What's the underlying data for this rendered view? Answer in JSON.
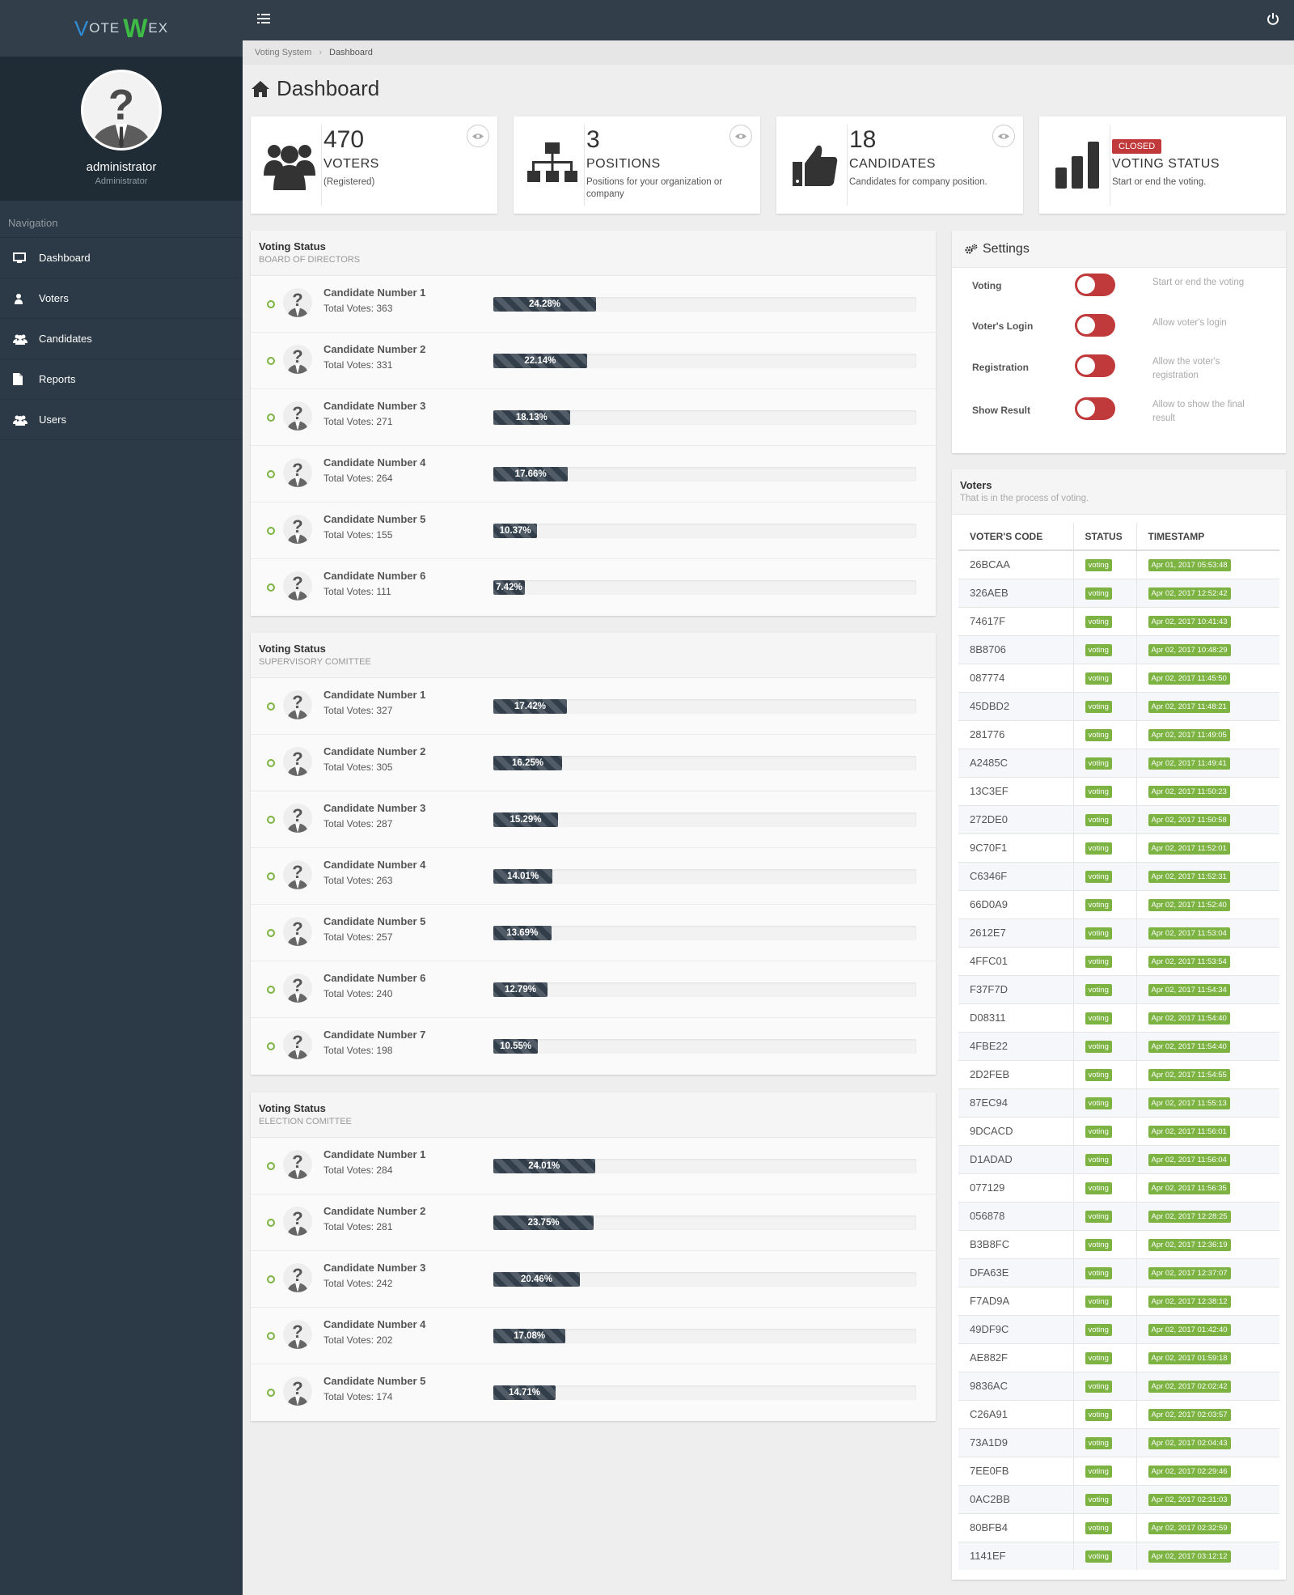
{
  "brand": {
    "part1": "V",
    "part2": "OTE",
    "part3": "W",
    "part4": "EX"
  },
  "profile": {
    "name": "administrator",
    "role": "Administrator"
  },
  "navigation": {
    "title": "Navigation",
    "items": [
      {
        "label": "Dashboard",
        "icon": "monitor-icon"
      },
      {
        "label": "Voters",
        "icon": "user-icon"
      },
      {
        "label": "Candidates",
        "icon": "users-icon"
      },
      {
        "label": "Reports",
        "icon": "file-icon"
      },
      {
        "label": "Users",
        "icon": "users-icon"
      }
    ]
  },
  "breadcrumb": {
    "root": "Voting System",
    "current": "Dashboard"
  },
  "page_title": "Dashboard",
  "stats": {
    "voters": {
      "number": "470",
      "title": "VOTERS",
      "desc": "(Registered)"
    },
    "positions": {
      "number": "3",
      "title": "POSITIONS",
      "desc": "Positions for your organization or company"
    },
    "candidates": {
      "number": "18",
      "title": "CANDIDATES",
      "desc": "Candidates for company position."
    },
    "voting_status": {
      "badge": "CLOSED",
      "title": "VOTING STATUS",
      "desc": "Start or end the voting."
    }
  },
  "voting_panels": [
    {
      "title": "Voting Status",
      "subtitle": "BOARD OF DIRECTORS",
      "candidates": [
        {
          "name": "Candidate Number 1",
          "votes": "Total Votes: 363",
          "percent": 24.28,
          "percent_label": "24.28%"
        },
        {
          "name": "Candidate Number 2",
          "votes": "Total Votes: 331",
          "percent": 22.14,
          "percent_label": "22.14%"
        },
        {
          "name": "Candidate Number 3",
          "votes": "Total Votes: 271",
          "percent": 18.13,
          "percent_label": "18.13%"
        },
        {
          "name": "Candidate Number 4",
          "votes": "Total Votes: 264",
          "percent": 17.66,
          "percent_label": "17.66%"
        },
        {
          "name": "Candidate Number 5",
          "votes": "Total Votes: 155",
          "percent": 10.37,
          "percent_label": "10.37%"
        },
        {
          "name": "Candidate Number 6",
          "votes": "Total Votes: 111",
          "percent": 7.42,
          "percent_label": "7.42%"
        }
      ]
    },
    {
      "title": "Voting Status",
      "subtitle": "SUPERVISORY COMITTEE",
      "candidates": [
        {
          "name": "Candidate Number 1",
          "votes": "Total Votes: 327",
          "percent": 17.42,
          "percent_label": "17.42%"
        },
        {
          "name": "Candidate Number 2",
          "votes": "Total Votes: 305",
          "percent": 16.25,
          "percent_label": "16.25%"
        },
        {
          "name": "Candidate Number 3",
          "votes": "Total Votes: 287",
          "percent": 15.29,
          "percent_label": "15.29%"
        },
        {
          "name": "Candidate Number 4",
          "votes": "Total Votes: 263",
          "percent": 14.01,
          "percent_label": "14.01%"
        },
        {
          "name": "Candidate Number 5",
          "votes": "Total Votes: 257",
          "percent": 13.69,
          "percent_label": "13.69%"
        },
        {
          "name": "Candidate Number 6",
          "votes": "Total Votes: 240",
          "percent": 12.79,
          "percent_label": "12.79%"
        },
        {
          "name": "Candidate Number 7",
          "votes": "Total Votes: 198",
          "percent": 10.55,
          "percent_label": "10.55%"
        }
      ]
    },
    {
      "title": "Voting Status",
      "subtitle": "ELECTION COMITTEE",
      "candidates": [
        {
          "name": "Candidate Number 1",
          "votes": "Total Votes: 284",
          "percent": 24.01,
          "percent_label": "24.01%"
        },
        {
          "name": "Candidate Number 2",
          "votes": "Total Votes: 281",
          "percent": 23.75,
          "percent_label": "23.75%"
        },
        {
          "name": "Candidate Number 3",
          "votes": "Total Votes: 242",
          "percent": 20.46,
          "percent_label": "20.46%"
        },
        {
          "name": "Candidate Number 4",
          "votes": "Total Votes: 202",
          "percent": 17.08,
          "percent_label": "17.08%"
        },
        {
          "name": "Candidate Number 5",
          "votes": "Total Votes: 174",
          "percent": 14.71,
          "percent_label": "14.71%"
        }
      ]
    }
  ],
  "settings": {
    "title": "Settings",
    "rows": [
      {
        "label": "Voting",
        "hint": "Start or end the voting",
        "on": false
      },
      {
        "label": "Voter's Login",
        "hint": "Allow voter's login",
        "on": false
      },
      {
        "label": "Registration",
        "hint": "Allow the voter's registration",
        "on": false
      },
      {
        "label": "Show Result",
        "hint": "Allow to show the final result",
        "on": false
      }
    ]
  },
  "voters": {
    "title": "Voters",
    "subtitle": "That is in the process of voting.",
    "columns": [
      "VOTER'S CODE",
      "STATUS",
      "TIMESTAMP"
    ],
    "status_label": "voting",
    "rows": [
      {
        "code": "26BCAA",
        "status": "voting",
        "ts": "Apr 01, 2017 05:53:48"
      },
      {
        "code": "326AEB",
        "status": "voting",
        "ts": "Apr 02, 2017 12:52:42"
      },
      {
        "code": "74617F",
        "status": "voting",
        "ts": "Apr 02, 2017 10:41:43"
      },
      {
        "code": "8B8706",
        "status": "voting",
        "ts": "Apr 02, 2017 10:48:29"
      },
      {
        "code": "087774",
        "status": "voting",
        "ts": "Apr 02, 2017 11:45:50"
      },
      {
        "code": "45DBD2",
        "status": "voting",
        "ts": "Apr 02, 2017 11:48:21"
      },
      {
        "code": "281776",
        "status": "voting",
        "ts": "Apr 02, 2017 11:49:05"
      },
      {
        "code": "A2485C",
        "status": "voting",
        "ts": "Apr 02, 2017 11:49:41"
      },
      {
        "code": "13C3EF",
        "status": "voting",
        "ts": "Apr 02, 2017 11:50:23"
      },
      {
        "code": "272DE0",
        "status": "voting",
        "ts": "Apr 02, 2017 11:50:58"
      },
      {
        "code": "9C70F1",
        "status": "voting",
        "ts": "Apr 02, 2017 11:52:01"
      },
      {
        "code": "C6346F",
        "status": "voting",
        "ts": "Apr 02, 2017 11:52:31"
      },
      {
        "code": "66D0A9",
        "status": "voting",
        "ts": "Apr 02, 2017 11:52:40"
      },
      {
        "code": "2612E7",
        "status": "voting",
        "ts": "Apr 02, 2017 11:53:04"
      },
      {
        "code": "4FFC01",
        "status": "voting",
        "ts": "Apr 02, 2017 11:53:54"
      },
      {
        "code": "F37F7D",
        "status": "voting",
        "ts": "Apr 02, 2017 11:54:34"
      },
      {
        "code": "D08311",
        "status": "voting",
        "ts": "Apr 02, 2017 11:54:40"
      },
      {
        "code": "4FBE22",
        "status": "voting",
        "ts": "Apr 02, 2017 11:54:40"
      },
      {
        "code": "2D2FEB",
        "status": "voting",
        "ts": "Apr 02, 2017 11:54:55"
      },
      {
        "code": "87EC94",
        "status": "voting",
        "ts": "Apr 02, 2017 11:55:13"
      },
      {
        "code": "9DCACD",
        "status": "voting",
        "ts": "Apr 02, 2017 11:56:01"
      },
      {
        "code": "D1ADAD",
        "status": "voting",
        "ts": "Apr 02, 2017 11:56:04"
      },
      {
        "code": "077129",
        "status": "voting",
        "ts": "Apr 02, 2017 11:56:35"
      },
      {
        "code": "056878",
        "status": "voting",
        "ts": "Apr 02, 2017 12:28:25"
      },
      {
        "code": "B3B8FC",
        "status": "voting",
        "ts": "Apr 02, 2017 12:36:19"
      },
      {
        "code": "DFA63E",
        "status": "voting",
        "ts": "Apr 02, 2017 12:37:07"
      },
      {
        "code": "F7AD9A",
        "status": "voting",
        "ts": "Apr 02, 2017 12:38:12"
      },
      {
        "code": "49DF9C",
        "status": "voting",
        "ts": "Apr 02, 2017 01:42:40"
      },
      {
        "code": "AE882F",
        "status": "voting",
        "ts": "Apr 02, 2017 01:59:18"
      },
      {
        "code": "9836AC",
        "status": "voting",
        "ts": "Apr 02, 2017 02:02:42"
      },
      {
        "code": "C26A91",
        "status": "voting",
        "ts": "Apr 02, 2017 02:03:57"
      },
      {
        "code": "73A1D9",
        "status": "voting",
        "ts": "Apr 02, 2017 02:04:43"
      },
      {
        "code": "7EE0FB",
        "status": "voting",
        "ts": "Apr 02, 2017 02:29:46"
      },
      {
        "code": "0AC2BB",
        "status": "voting",
        "ts": "Apr 02, 2017 02:31:03"
      },
      {
        "code": "80BFB4",
        "status": "voting",
        "ts": "Apr 02, 2017 02:32:59"
      },
      {
        "code": "1141EF",
        "status": "voting",
        "ts": "Apr 02, 2017 03:12:12"
      }
    ]
  },
  "colors": {
    "sidebar": "#2b3a46",
    "topbar": "#323f4b",
    "bar": "#323f4b",
    "danger": "#c0393b",
    "success": "#7cb342"
  }
}
